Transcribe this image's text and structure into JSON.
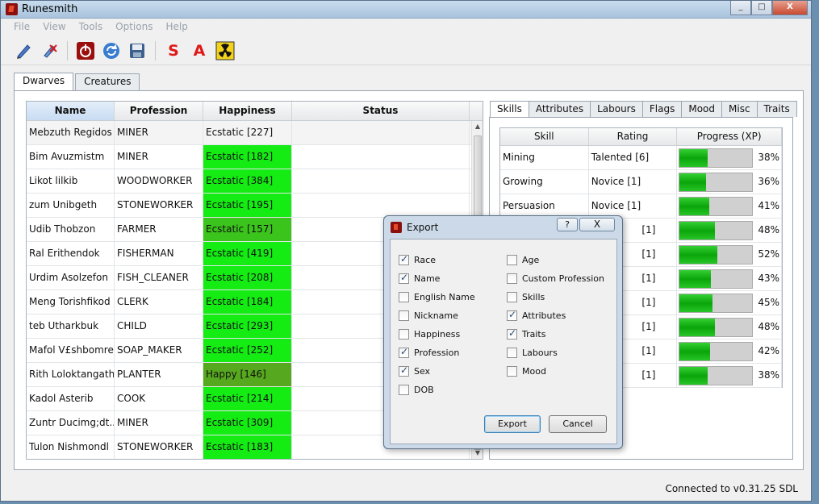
{
  "window": {
    "title": "Runesmith",
    "minimize": "_",
    "maximize": "□",
    "close": "X"
  },
  "menu": [
    "File",
    "View",
    "Tools",
    "Options",
    "Help"
  ],
  "toolbar": {
    "letter_s": "S",
    "letter_a": "A"
  },
  "main_tabs": [
    {
      "label": "Dwarves",
      "active": true
    },
    {
      "label": "Creatures",
      "active": false
    }
  ],
  "dwarf_table": {
    "headers": {
      "name": "Name",
      "profession": "Profession",
      "happiness": "Happiness",
      "status": "Status"
    },
    "rows": [
      {
        "name": "Mebzuth Regidos",
        "profession": "MINER",
        "happiness": "Ecstatic [227]",
        "level": "first"
      },
      {
        "name": "Bim Avuzmistm",
        "profession": "MINER",
        "happiness": "Ecstatic [182]",
        "level": "bright"
      },
      {
        "name": "Likot lilkib",
        "profession": "WOODWORKER",
        "happiness": "Ecstatic [384]",
        "level": "bright"
      },
      {
        "name": "zum Unibgeth",
        "profession": "STONEWORKER",
        "happiness": "Ecstatic [195]",
        "level": "bright"
      },
      {
        "name": "Udib Thobzon",
        "profession": "FARMER",
        "happiness": "Ecstatic [157]",
        "level": "mid"
      },
      {
        "name": "Ral Erithendok",
        "profession": "FISHERMAN",
        "happiness": "Ecstatic [419]",
        "level": "bright"
      },
      {
        "name": "Urdim Asolzefon",
        "profession": "FISH_CLEANER",
        "happiness": "Ecstatic [208]",
        "level": "bright"
      },
      {
        "name": "Meng Torishfikod",
        "profession": "CLERK",
        "happiness": "Ecstatic [184]",
        "level": "bright"
      },
      {
        "name": "teb Utharkbuk",
        "profession": "CHILD",
        "happiness": "Ecstatic [293]",
        "level": "bright"
      },
      {
        "name": "Mafol V£shbomrek",
        "profession": "SOAP_MAKER",
        "happiness": "Ecstatic [252]",
        "level": "bright"
      },
      {
        "name": "Rith Loloktangath",
        "profession": "PLANTER",
        "happiness": "Happy [146]",
        "level": "dark"
      },
      {
        "name": "Kadol Asterib",
        "profession": "COOK",
        "happiness": "Ecstatic [214]",
        "level": "bright"
      },
      {
        "name": "Zuntr Ducimg;dt...",
        "profession": "MINER",
        "happiness": "Ecstatic [309]",
        "level": "bright"
      },
      {
        "name": "Tulon Nishmondl",
        "profession": "STONEWORKER",
        "happiness": "Ecstatic [183]",
        "level": "bright"
      }
    ]
  },
  "detail_tabs": [
    {
      "label": "Skills",
      "active": true
    },
    {
      "label": "Attributes",
      "active": false
    },
    {
      "label": "Labours",
      "active": false
    },
    {
      "label": "Flags",
      "active": false
    },
    {
      "label": "Mood",
      "active": false
    },
    {
      "label": "Misc",
      "active": false
    },
    {
      "label": "Traits",
      "active": false
    }
  ],
  "skill_table": {
    "headers": {
      "skill": "Skill",
      "rating": "Rating",
      "progress": "Progress (XP)"
    },
    "rows": [
      {
        "skill": "Mining",
        "rating": "Talented [6]",
        "progress": 38,
        "progress_label": "38%"
      },
      {
        "skill": "Growing",
        "rating": "Novice [1]",
        "progress": 36,
        "progress_label": "36%"
      },
      {
        "skill": "Persuasion",
        "rating": "Novice [1]",
        "progress": 41,
        "progress_label": "41%"
      },
      {
        "skill": "",
        "rating": "[1]",
        "progress": 48,
        "progress_label": "48%"
      },
      {
        "skill": "",
        "rating": "[1]",
        "progress": 52,
        "progress_label": "52%"
      },
      {
        "skill": "",
        "rating": "[1]",
        "progress": 43,
        "progress_label": "43%"
      },
      {
        "skill": "",
        "rating": "[1]",
        "progress": 45,
        "progress_label": "45%"
      },
      {
        "skill": "",
        "rating": "[1]",
        "progress": 48,
        "progress_label": "48%"
      },
      {
        "skill": "",
        "rating": "[1]",
        "progress": 42,
        "progress_label": "42%"
      },
      {
        "skill": "",
        "rating": "[1]",
        "progress": 38,
        "progress_label": "38%"
      }
    ]
  },
  "export_dialog": {
    "title": "Export",
    "help": "?",
    "close": "X",
    "left_options": [
      {
        "label": "Race",
        "checked": true
      },
      {
        "label": "Name",
        "checked": true
      },
      {
        "label": "English Name",
        "checked": false
      },
      {
        "label": "Nickname",
        "checked": false
      },
      {
        "label": "Happiness",
        "checked": false
      },
      {
        "label": "Profession",
        "checked": true
      },
      {
        "label": "Sex",
        "checked": true
      },
      {
        "label": "DOB",
        "checked": false
      }
    ],
    "right_options": [
      {
        "label": "Age",
        "checked": false
      },
      {
        "label": "Custom Profession",
        "checked": false
      },
      {
        "label": "Skills",
        "checked": false
      },
      {
        "label": "Attributes",
        "checked": true
      },
      {
        "label": "Traits",
        "checked": true
      },
      {
        "label": "Labours",
        "checked": false
      },
      {
        "label": "Mood",
        "checked": false
      }
    ],
    "export_label": "Export",
    "cancel_label": "Cancel"
  },
  "status_bar": {
    "text": "Connected to v0.31.25 SDL"
  },
  "icons": {
    "toolbar": [
      "pencil-icon",
      "clear-icon",
      "power-icon",
      "refresh-icon",
      "save-icon",
      "letter-s-icon",
      "letter-a-icon",
      "radiation-icon"
    ]
  }
}
